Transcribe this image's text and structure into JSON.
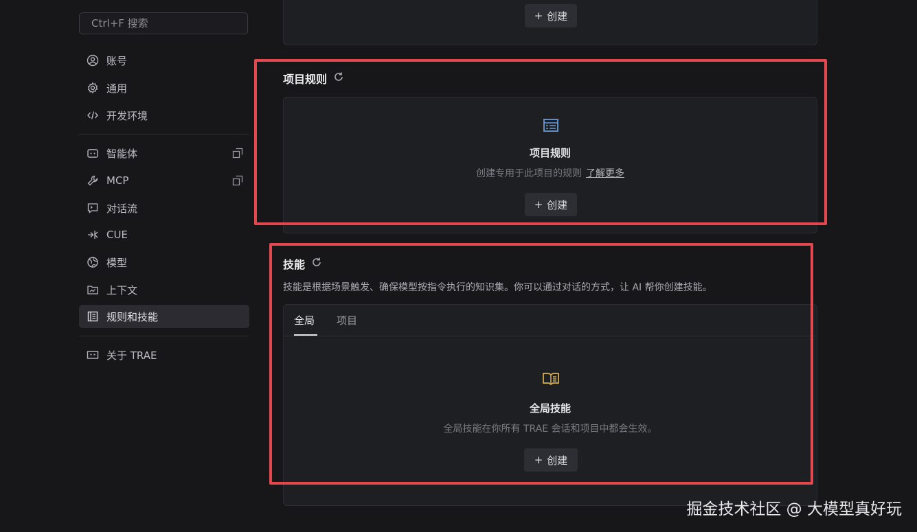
{
  "sidebar": {
    "search_placeholder": "Ctrl+F 搜索",
    "items": [
      {
        "label": "账号",
        "icon": "user-circle-icon"
      },
      {
        "label": "通用",
        "icon": "gear-icon"
      },
      {
        "label": "开发环境",
        "icon": "code-icon"
      },
      {
        "label": "智能体",
        "icon": "bot-icon"
      },
      {
        "label": "MCP",
        "icon": "wrench-icon"
      },
      {
        "label": "对话流",
        "icon": "terminal-chat-icon"
      },
      {
        "label": "CUE",
        "icon": "cue-icon"
      },
      {
        "label": "模型",
        "icon": "globe-icon"
      },
      {
        "label": "上下文",
        "icon": "folder-icon"
      },
      {
        "label": "规则和技能",
        "icon": "book-icon",
        "active": true
      },
      {
        "label": "关于 TRAE",
        "icon": "trae-icon"
      }
    ]
  },
  "top_card": {
    "create_label": "创建"
  },
  "project_rules": {
    "title": "项目规则",
    "empty_title": "项目规则",
    "empty_desc": "创建专用于此项目的规则",
    "learn_more": "了解更多",
    "create_label": "创建"
  },
  "skills": {
    "title": "技能",
    "description": "技能是根据场景触发、确保模型按指令执行的知识集。你可以通过对话的方式，让 AI 帮你创建技能。",
    "tabs": [
      "全局",
      "项目"
    ],
    "active_tab": "全局",
    "empty_title": "全局技能",
    "empty_desc": "全局技能在你所有 TRAE 会话和项目中都会生效。",
    "create_label": "创建"
  },
  "watermark": "掘金技术社区 @ 大模型真好玩",
  "colors": {
    "highlight_box": "#e2484d",
    "rule_icon": "#6a9bd8",
    "skill_icon": "#d9b24c"
  }
}
